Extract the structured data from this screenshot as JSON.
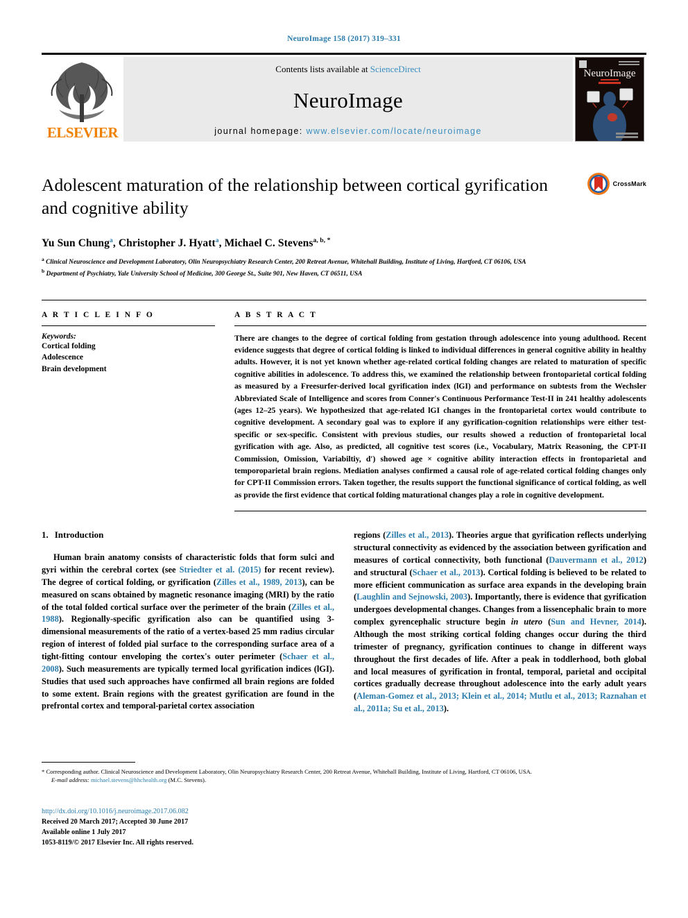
{
  "running_head": "NeuroImage 158 (2017) 319–331",
  "masthead": {
    "contents_prefix": "Contents lists available at ",
    "contents_link": "ScienceDirect",
    "journal_name": "NeuroImage",
    "homepage_prefix": "journal homepage: ",
    "homepage_url": "www.elsevier.com/locate/neuroimage",
    "publisher": "ELSEVIER",
    "cover_title": "NeuroImage",
    "accent_link": "#3a8fc0",
    "publisher_color": "#f08000"
  },
  "article": {
    "title": "Adolescent maturation of the relationship between cortical gyrification and cognitive ability",
    "crossmark_label": "CrossMark",
    "authors": [
      {
        "name": "Yu Sun Chung",
        "sup": "a"
      },
      {
        "name": "Christopher J. Hyatt",
        "sup": "a"
      },
      {
        "name": "Michael C. Stevens",
        "sup": "a, b, *"
      }
    ],
    "affiliations": [
      {
        "marker": "a",
        "text": "Clinical Neuroscience and Development Laboratory, Olin Neuropsychiatry Research Center, 200 Retreat Avenue, Whitehall Building, Institute of Living, Hartford, CT 06106, USA"
      },
      {
        "marker": "b",
        "text": "Department of Psychiatry, Yale University School of Medicine, 300 George St., Suite 901, New Haven, CT 06511, USA"
      }
    ]
  },
  "article_info": {
    "heading": "A R T I C L E  I N F O",
    "keywords_label": "Keywords:",
    "keywords": [
      "Cortical folding",
      "Adolescence",
      "Brain development"
    ]
  },
  "abstract": {
    "heading": "A B S T R A C T",
    "text": "There are changes to the degree of cortical folding from gestation through adolescence into young adulthood. Recent evidence suggests that degree of cortical folding is linked to individual differences in general cognitive ability in healthy adults. However, it is not yet known whether age-related cortical folding changes are related to maturation of specific cognitive abilities in adolescence. To address this, we examined the relationship between frontoparietal cortical folding as measured by a Freesurfer-derived local gyrification index (lGI) and performance on subtests from the Wechsler Abbreviated Scale of Intelligence and scores from Conner's Continuous Performance Test-II in 241 healthy adolescents (ages 12–25 years). We hypothesized that age-related lGI changes in the frontoparietal cortex would contribute to cognitive development. A secondary goal was to explore if any gyrification-cognition relationships were either test-specific or sex-specific. Consistent with previous studies, our results showed a reduction of frontoparietal local gyrification with age. Also, as predicted, all cognitive test scores (i.e., Vocabulary, Matrix Reasoning, the CPT-II Commission, Omission, Variabiltiy, d′) showed age × cognitive ability interaction effects in frontoparietal and temporoparietal brain regions. Mediation analyses confirmed a causal role of age-related cortical folding changes only for CPT-II Commission errors. Taken together, the results support the functional significance of cortical folding, as well as provide the first evidence that cortical folding maturational changes play a role in cognitive development."
  },
  "introduction": {
    "number": "1.",
    "heading": "Introduction",
    "left_paragraph_parts": [
      {
        "t": "Human brain anatomy consists of characteristic folds that form sulci and gyri within the cerebral cortex (see ",
        "cite": false
      },
      {
        "t": "Striedter et al. (2015)",
        "cite": true
      },
      {
        "t": " for recent review). The degree of cortical folding, or gyrification (",
        "cite": false
      },
      {
        "t": "Zilles et al., 1989, 2013",
        "cite": true
      },
      {
        "t": "), can be measured on scans obtained by magnetic resonance imaging (MRI) by the ratio of the total folded cortical surface over the perimeter of the brain (",
        "cite": false
      },
      {
        "t": "Zilles et al., 1988",
        "cite": true
      },
      {
        "t": "). Regionally-specific gyrification also can be quantified using 3-dimensional measurements of the ratio of a vertex-based 25 mm radius circular region of interest of folded pial surface to the corresponding surface area of a tight-fitting contour enveloping the cortex's outer perimeter (",
        "cite": false
      },
      {
        "t": "Schaer et al., 2008",
        "cite": true
      },
      {
        "t": "). Such measurements are typically termed local gyrification indices (lGI). Studies that used such approaches have confirmed all brain regions are folded to some extent. Brain regions with the greatest gyrification are found in the prefrontal cortex and temporal-parietal cortex association ",
        "cite": false
      }
    ],
    "right_paragraph_parts": [
      {
        "t": "regions (",
        "cite": false
      },
      {
        "t": "Zilles et al., 2013",
        "cite": true
      },
      {
        "t": "). Theories argue that gyrification reflects underlying structural connectivity as evidenced by the association between gyrification and measures of cortical connectivity, both functional (",
        "cite": false
      },
      {
        "t": "Dauvermann et al., 2012",
        "cite": true
      },
      {
        "t": ") and structural (",
        "cite": false
      },
      {
        "t": "Schaer et al., 2013",
        "cite": true
      },
      {
        "t": "). Cortical folding is believed to be related to more efficient communication as surface area expands in the developing brain (",
        "cite": false
      },
      {
        "t": "Laughlin and Sejnowski, 2003",
        "cite": true
      },
      {
        "t": "). Importantly, there is evidence that gyrification undergoes developmental changes. Changes from a lissencephalic brain to more complex gyrencephalic structure begin ",
        "cite": false
      },
      {
        "t": "in utero",
        "cite": false,
        "italic": true
      },
      {
        "t": " (",
        "cite": false
      },
      {
        "t": "Sun and Hevner, 2014",
        "cite": true
      },
      {
        "t": "). Although the most striking cortical folding changes occur during the third trimester of pregnancy, gyrification continues to change in different ways throughout the first decades of life. After a peak in toddlerhood, both global and local measures of gyrification in frontal, temporal, parietal and occipital cortices gradually decrease throughout adolescence into the early adult years (",
        "cite": false
      },
      {
        "t": "Aleman-Gomez et al., 2013; Klein et al., 2014; Mutlu et al., 2013; Raznahan et al., 2011a; Su et al., 2013",
        "cite": true
      },
      {
        "t": ").",
        "cite": false
      }
    ]
  },
  "footnotes": {
    "corresponding": "* Corresponding author. Clinical Neuroscience and Development Laboratory, Olin Neuropsychiatry Research Center, 200 Retreat Avenue, Whitehall Building, Institute of Living, Hartford, CT 06106, USA.",
    "email_label": "E-mail address:",
    "email": "michael.stevens@hhchealth.org",
    "email_suffix": "(M.C. Stevens)."
  },
  "imprint": {
    "doi": "http://dx.doi.org/10.1016/j.neuroimage.2017.06.082",
    "received": "Received 20 March 2017; Accepted 30 June 2017",
    "available": "Available online 1 July 2017",
    "copyright": "1053-8119/© 2017 Elsevier Inc. All rights reserved."
  }
}
